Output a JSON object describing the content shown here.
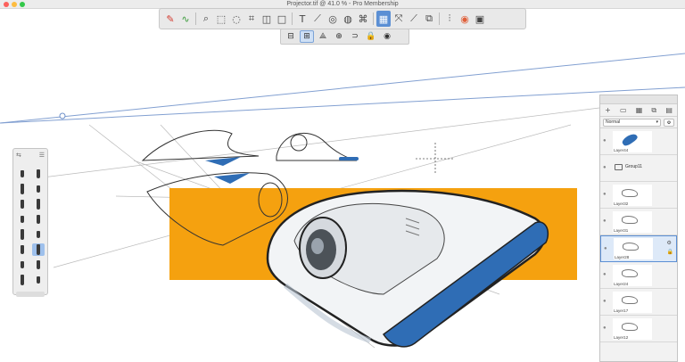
{
  "window": {
    "title": "Projector.tif @ 41.0 % - Pro Membership"
  },
  "toolbar": {
    "tools": [
      {
        "name": "brush-red-icon",
        "glyph": "✎",
        "color": "#d33a2f"
      },
      {
        "name": "brush-green-icon",
        "glyph": "∿",
        "color": "#3a9b3a"
      },
      {
        "name": "zoom-icon",
        "glyph": "⌕"
      },
      {
        "name": "select-rect-icon",
        "glyph": "⬚"
      },
      {
        "name": "select-lasso-icon",
        "glyph": "◌"
      },
      {
        "name": "crop-icon",
        "glyph": "⌗"
      },
      {
        "name": "transform-icon",
        "glyph": "◫"
      },
      {
        "name": "canvas-icon",
        "glyph": "□"
      },
      {
        "name": "text-icon",
        "glyph": "T"
      },
      {
        "name": "ruler-icon",
        "glyph": "⟋"
      },
      {
        "name": "ellipse-guide-icon",
        "glyph": "◎"
      },
      {
        "name": "french-curve-icon",
        "glyph": "◍"
      },
      {
        "name": "symmetry-icon",
        "glyph": "⌘"
      },
      {
        "name": "perspective-icon",
        "glyph": "▦",
        "active": true
      },
      {
        "name": "distort-icon",
        "glyph": "⤧"
      },
      {
        "name": "stroke-icon",
        "glyph": "⟋"
      },
      {
        "name": "shapes-icon",
        "glyph": "⧉"
      },
      {
        "name": "brush-library-icon",
        "glyph": "⫶"
      },
      {
        "name": "color-wheel-icon",
        "glyph": "◉",
        "color": "#e0603a"
      },
      {
        "name": "color-swatches-icon",
        "glyph": "▣"
      }
    ]
  },
  "subbar": {
    "tools": [
      {
        "name": "perspective-1pt-icon",
        "glyph": "⊟"
      },
      {
        "name": "perspective-2pt-icon",
        "glyph": "⊞",
        "active": true
      },
      {
        "name": "perspective-3pt-icon",
        "glyph": "⟁"
      },
      {
        "name": "perspective-grid-icon",
        "glyph": "⊕"
      },
      {
        "name": "snap-icon",
        "glyph": "⊃"
      },
      {
        "name": "lock-icon",
        "glyph": "🔒"
      },
      {
        "name": "visibility-icon",
        "glyph": "◉"
      }
    ]
  },
  "layers": {
    "blend_mode": "Normal",
    "items": [
      {
        "name": "Layer44",
        "type": "layer"
      },
      {
        "name": "Group11",
        "type": "group"
      },
      {
        "name": "Layer32",
        "type": "layer"
      },
      {
        "name": "Layer31",
        "type": "layer"
      },
      {
        "name": "Layer28",
        "type": "layer",
        "active": true
      },
      {
        "name": "Layer24",
        "type": "layer"
      },
      {
        "name": "Layer17",
        "type": "layer"
      },
      {
        "name": "Layer12",
        "type": "layer"
      }
    ]
  },
  "colors": {
    "accent": "#5b8fd4",
    "orange": "#f5a10f",
    "blue_trim": "#2f6db5"
  }
}
